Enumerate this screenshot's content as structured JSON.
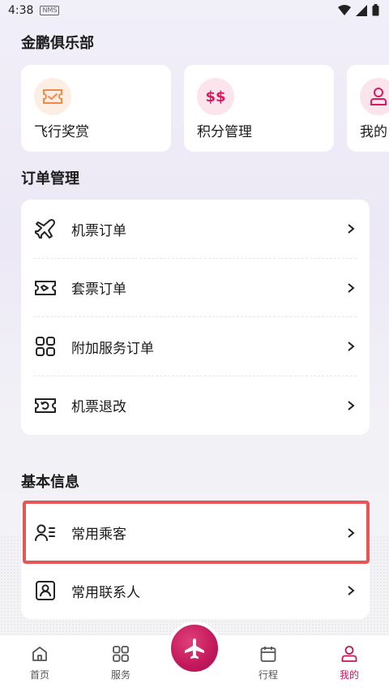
{
  "status": {
    "time": "4:38",
    "nfc": "NMS"
  },
  "club": {
    "title": "金鹏俱乐部",
    "items": [
      {
        "label": "飞行奖赏",
        "icon": "ticket-check-icon",
        "icon_bg": "#fdeee3",
        "icon_color": "#f08a4b"
      },
      {
        "label": "积分管理",
        "icon": "double-dollar-icon",
        "icon_bg": "#fbe4ec",
        "icon_color": "#d81b60"
      },
      {
        "label": "我的",
        "icon": "user-icon",
        "icon_bg": "#fbe4ec",
        "icon_color": "#d81b60"
      }
    ]
  },
  "orders": {
    "title": "订单管理",
    "items": [
      {
        "label": "机票订单",
        "icon": "plane-icon"
      },
      {
        "label": "套票订单",
        "icon": "ticket-icon"
      },
      {
        "label": "附加服务订单",
        "icon": "grid-icon"
      },
      {
        "label": "机票退改",
        "icon": "refund-icon"
      }
    ]
  },
  "basic": {
    "title": "基本信息",
    "items": [
      {
        "label": "常用乘客",
        "icon": "passenger-list-icon"
      },
      {
        "label": "常用联系人",
        "icon": "contact-card-icon"
      }
    ]
  },
  "nav": {
    "items": [
      {
        "label": "首页",
        "icon": "home-icon",
        "active": false
      },
      {
        "label": "服务",
        "icon": "grid-icon",
        "active": false
      },
      {
        "label": "行程",
        "icon": "calendar-icon",
        "active": false
      },
      {
        "label": "我的",
        "icon": "user-icon",
        "active": true
      }
    ],
    "center": {
      "icon": "plane-icon"
    },
    "active_color": "#c2185b"
  }
}
